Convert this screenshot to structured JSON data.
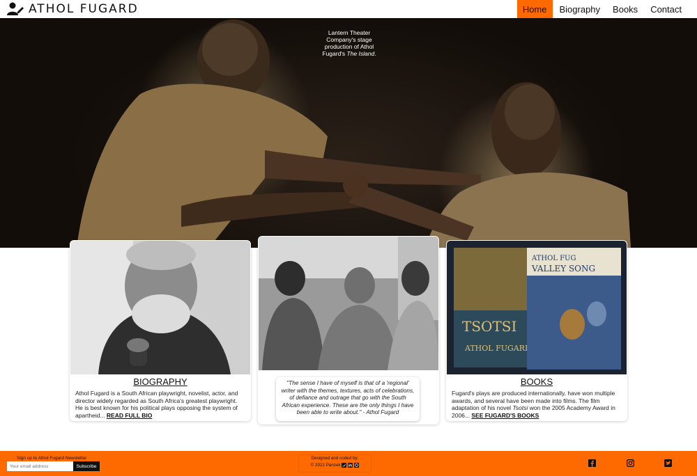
{
  "brand": {
    "title": "ATHOL FUGARD",
    "icon": "user-pen-icon"
  },
  "nav": {
    "items": [
      {
        "label": "Home",
        "active": true
      },
      {
        "label": "Biography",
        "active": false
      },
      {
        "label": "Books",
        "active": false
      },
      {
        "label": "Contact",
        "active": false
      }
    ]
  },
  "hero": {
    "caption_line": "Lantern Theater Company's stage production of Athol Fugard's ",
    "caption_italic": "The Island",
    "caption_end": "."
  },
  "cards": {
    "bio": {
      "title": "BIOGRAPHY",
      "text": "Athol Fugard is a South African playwright, novelist, actor, and director widely regarded as South Africa's greatest playwright. He is best known for his political plays opposing the system of apartheid... ",
      "link": "READ FULL BIO"
    },
    "quote": {
      "text": "\"The sense I have of myself is that of a 'regional' writer with the themes, textures, acts of celebrations, of defiance and outrage that go with the South African experience. These are the only things I have been able to write about.\" - Athol Fugard"
    },
    "books": {
      "title": "BOOKS",
      "text_before": "Fugard's plays are produced internationally, have won multiple awards, and several have been made into films. The film adaptation of his novel ",
      "text_italic": "Tsotsi",
      "text_after": " won the 2005 Academy Award in 2006... ",
      "link": "SEE FUGARD'S BOOKS",
      "book1": "TSOTSI",
      "book1_author": "ATHOL FUGARD",
      "book2_top": "ATHOL FUG",
      "book2_title": "VALLEY SONG"
    }
  },
  "footer": {
    "newsletter_label": "Sign up to Athol Fugard Newsletter",
    "email_placeholder": "Your email address",
    "subscribe_label": "Subscribe",
    "credit_line": "Designed and coded by:",
    "copyright": "© 2022 Panzek",
    "social": [
      "facebook-icon",
      "instagram-icon",
      "twitter-icon"
    ]
  },
  "colors": {
    "accent": "#ff6a00",
    "hero_bg": "#120d09"
  }
}
